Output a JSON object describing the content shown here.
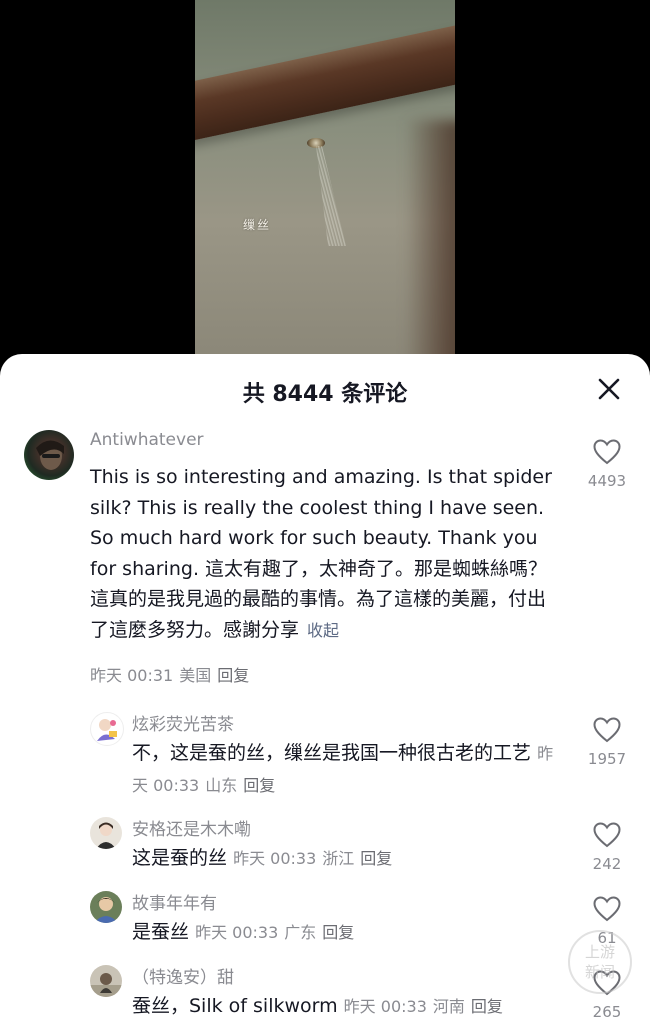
{
  "video": {
    "caption": "缫丝"
  },
  "sheet": {
    "title": "共 8444 条评论"
  },
  "comments": [
    {
      "user": "Antiwhatever",
      "text": "This is so interesting and amazing. Is that spider silk? This is really the coolest thing I have seen. So much hard work for such beauty. Thank you for sharing. 這太有趣了，太神奇了。那是蜘蛛絲嗎？這真的是我見過的最酷的事情。為了這樣的美麗，付出了這麼多努力。感謝分享",
      "collapse_label": "收起",
      "time": "昨天 00:31",
      "location": "美国",
      "reply_label": "回复",
      "likes": "4493"
    }
  ],
  "replies": [
    {
      "user": "炫彩荧光苦茶",
      "text": "不，这是蚕的丝，缫丝是我国一种很古老的工艺",
      "time": "昨天 00:33",
      "location": "山东",
      "reply_label": "回复",
      "likes": "1957"
    },
    {
      "user": "安格还是木木嘞",
      "text": "这是蚕的丝",
      "time": "昨天 00:33",
      "location": "浙江",
      "reply_label": "回复",
      "likes": "242"
    },
    {
      "user": "故事年年有",
      "text": "是蚕丝",
      "time": "昨天 00:33",
      "location": "广东",
      "reply_label": "回复",
      "likes": "61"
    },
    {
      "user": "（特逸安）甜",
      "text": "蚕丝，Silk of silkworm",
      "time": "昨天 00:33",
      "location": "河南",
      "reply_label": "回复",
      "likes": "265"
    }
  ],
  "watermark": {
    "line1": "上游",
    "line2": "新闻"
  },
  "colors": {
    "sheet_bg": "#ffffff",
    "text_primary": "#161823",
    "text_secondary": "#8a8b91",
    "link": "#5d6a84"
  },
  "icons": {
    "close": "close-icon",
    "like": "heart-outline-icon"
  }
}
